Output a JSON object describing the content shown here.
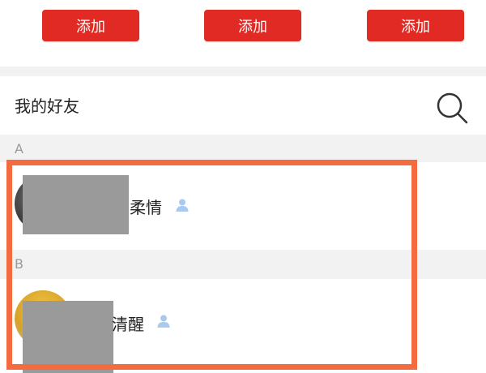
{
  "top_cards": {
    "items": [
      {
        "button_label": "添加"
      },
      {
        "button_label": "添加"
      },
      {
        "button_label": "添加"
      }
    ]
  },
  "friends": {
    "title": "我的好友",
    "search_icon": "search-icon",
    "sections": [
      {
        "letter": "A",
        "contacts": [
          {
            "name": "柔情",
            "badge_icon": "person-icon"
          }
        ]
      },
      {
        "letter": "B",
        "contacts": [
          {
            "name": "清醒",
            "badge_icon": "person-icon"
          }
        ]
      }
    ]
  },
  "colors": {
    "add_button": "#e02a23",
    "highlight_frame": "#f46b3f",
    "person_icon": "#a9c9ee",
    "section_bg": "#f2f2f2"
  }
}
